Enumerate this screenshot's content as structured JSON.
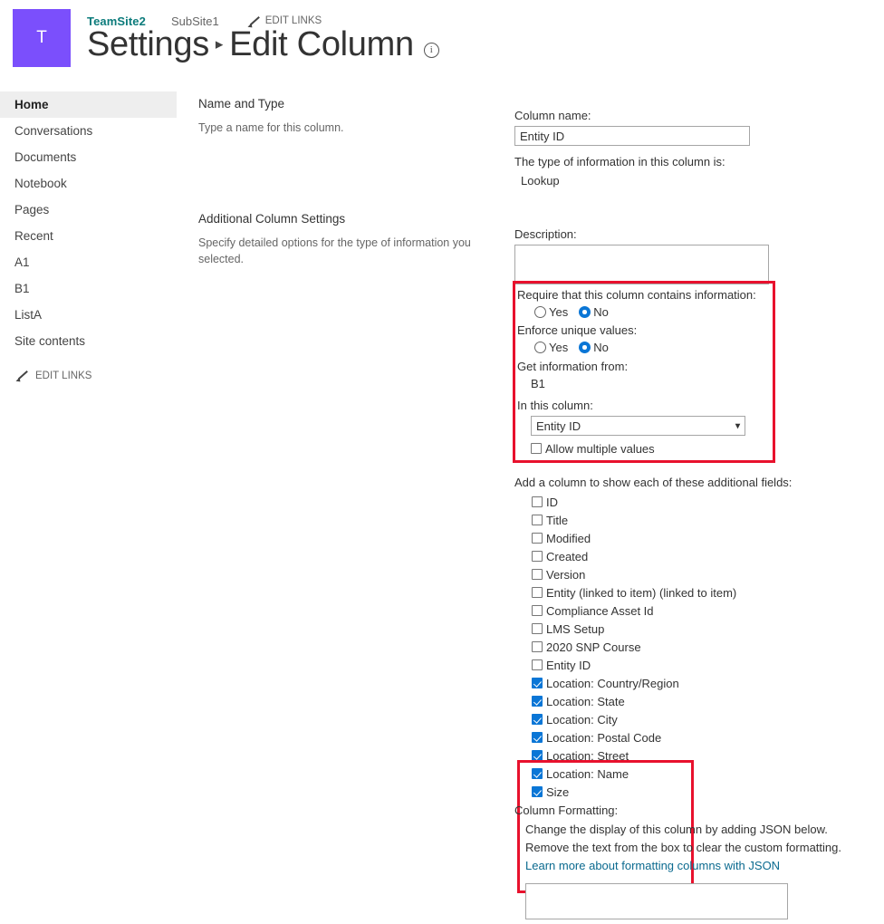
{
  "header": {
    "logo_letter": "T",
    "site_name": "TeamSite2",
    "subsite_name": "SubSite1",
    "edit_links_label": "EDIT LINKS",
    "title_first": "Settings",
    "title_separator": "▸",
    "title_second": "Edit Column",
    "info_glyph": "i"
  },
  "sidebar": {
    "items": [
      {
        "label": "Home",
        "selected": true
      },
      {
        "label": "Conversations",
        "selected": false
      },
      {
        "label": "Documents",
        "selected": false
      },
      {
        "label": "Notebook",
        "selected": false
      },
      {
        "label": "Pages",
        "selected": false
      },
      {
        "label": "Recent",
        "selected": false
      },
      {
        "label": "A1",
        "selected": false
      },
      {
        "label": "B1",
        "selected": false
      },
      {
        "label": "ListA",
        "selected": false
      },
      {
        "label": "Site contents",
        "selected": false
      }
    ],
    "edit_links_label": "EDIT LINKS"
  },
  "sections": {
    "name_and_type": {
      "title": "Name and Type",
      "description": "Type a name for this column."
    },
    "additional_column_settings": {
      "title": "Additional Column Settings",
      "description": "Specify detailed options for the type of information you selected."
    }
  },
  "fields": {
    "column_name_label": "Column name:",
    "column_name_value": "Entity ID",
    "type_label": "The type of information in this column is:",
    "type_value": "Lookup",
    "description_label": "Description:",
    "description_value": "",
    "require_label": "Require that this column contains information:",
    "require_options": [
      "Yes",
      "No"
    ],
    "require_selected": "No",
    "enforce_label": "Enforce unique values:",
    "enforce_options": [
      "Yes",
      "No"
    ],
    "enforce_selected": "No",
    "get_info_label": "Get information from:",
    "get_info_value": "B1",
    "in_this_column_label": "In this column:",
    "in_this_column_value": "Entity ID",
    "allow_multiple_label": "Allow multiple values",
    "allow_multiple_checked": false,
    "additional_fields_label": "Add a column to show each of these additional fields:",
    "additional_fields": [
      {
        "label": "ID",
        "checked": false
      },
      {
        "label": "Title",
        "checked": false
      },
      {
        "label": "Modified",
        "checked": false
      },
      {
        "label": "Created",
        "checked": false
      },
      {
        "label": "Version",
        "checked": false
      },
      {
        "label": "Entity (linked to item) (linked to item)",
        "checked": false
      },
      {
        "label": "Compliance Asset Id",
        "checked": false
      },
      {
        "label": "LMS Setup",
        "checked": false
      },
      {
        "label": "2020 SNP Course",
        "checked": false
      },
      {
        "label": "Entity ID",
        "checked": false
      },
      {
        "label": "Location: Country/Region",
        "checked": true
      },
      {
        "label": "Location: State",
        "checked": true
      },
      {
        "label": "Location: City",
        "checked": true
      },
      {
        "label": "Location: Postal Code",
        "checked": true
      },
      {
        "label": "Location: Street",
        "checked": true
      },
      {
        "label": "Location: Name",
        "checked": true
      },
      {
        "label": "Size",
        "checked": true
      }
    ],
    "column_formatting_label": "Column Formatting:",
    "column_formatting_line1": "Change the display of this column by adding JSON below.",
    "column_formatting_line2": "Remove the text from the box to clear the custom formatting.",
    "column_formatting_link": "Learn more about formatting columns with JSON",
    "json_value": ""
  },
  "colors": {
    "logo_bg": "#7b4ffc",
    "site_link": "#0b7b7b",
    "accent_blue": "#0a76d6",
    "annotation_red": "#e8112d",
    "link_blue": "#0b6a8f",
    "nav_selected_bg": "#eeeeee"
  }
}
